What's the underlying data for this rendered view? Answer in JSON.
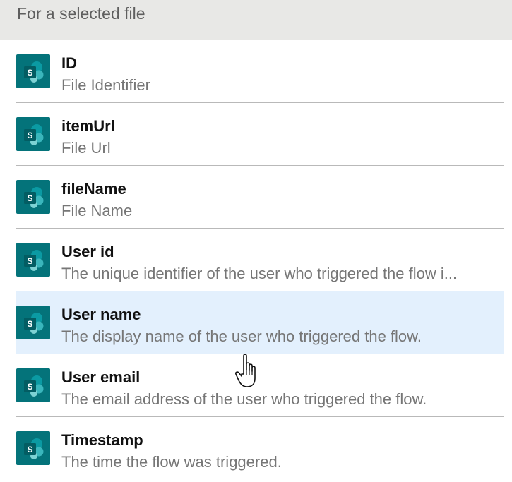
{
  "section": {
    "header": "For a selected file"
  },
  "items": [
    {
      "title": "ID",
      "description": "File Identifier",
      "icon": "sharepoint-icon"
    },
    {
      "title": "itemUrl",
      "description": "File Url",
      "icon": "sharepoint-icon"
    },
    {
      "title": "fileName",
      "description": "File Name",
      "icon": "sharepoint-icon"
    },
    {
      "title": "User id",
      "description": "The unique identifier of the user who triggered the flow i...",
      "icon": "sharepoint-icon"
    },
    {
      "title": "User name",
      "description": "The display name of the user who triggered the flow.",
      "icon": "sharepoint-icon"
    },
    {
      "title": "User email",
      "description": "The email address of the user who triggered the flow.",
      "icon": "sharepoint-icon"
    },
    {
      "title": "Timestamp",
      "description": "The time the flow was triggered.",
      "icon": "sharepoint-icon"
    }
  ],
  "colors": {
    "icon_background": "#04737a",
    "hover_background": "#e3f0fd",
    "header_background": "#e8e8e6"
  },
  "hovered_item": "User name"
}
